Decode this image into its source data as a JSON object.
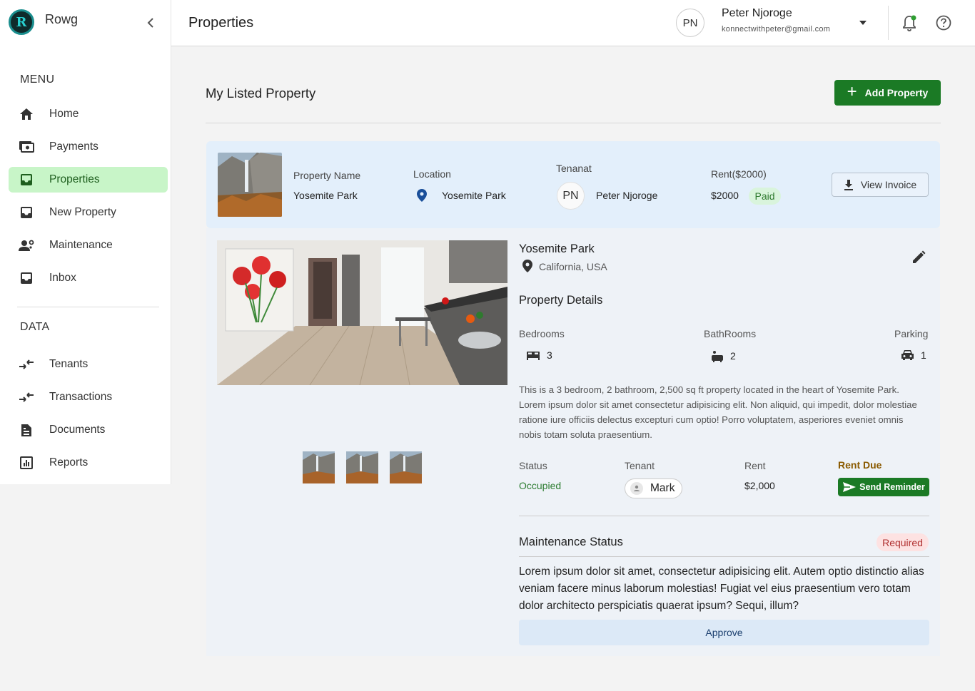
{
  "app": {
    "brand": "Rowg",
    "page_title": "Properties"
  },
  "user": {
    "initials": "PN",
    "name": "Peter Njoroge",
    "email": "konnectwithpeter@gmail.com"
  },
  "sidebar": {
    "menu_title": "MENU",
    "data_title": "DATA",
    "menu_items": [
      {
        "label": "Home",
        "icon": "home-icon"
      },
      {
        "label": "Payments",
        "icon": "payments-icon"
      },
      {
        "label": "Properties",
        "icon": "inbox-icon",
        "active": true
      },
      {
        "label": "New Property",
        "icon": "inbox-icon"
      },
      {
        "label": "Maintenance",
        "icon": "engineering-icon"
      },
      {
        "label": "Inbox",
        "icon": "inbox-icon"
      }
    ],
    "data_items": [
      {
        "label": "Tenants",
        "icon": "compare-arrows-icon"
      },
      {
        "label": "Transactions",
        "icon": "compare-arrows-icon"
      },
      {
        "label": "Documents",
        "icon": "document-icon"
      },
      {
        "label": "Reports",
        "icon": "bar-chart-icon"
      }
    ]
  },
  "main": {
    "heading": "My Listed Property",
    "add_button": "Add Property"
  },
  "summary": {
    "property_name_label": "Property Name",
    "property_name": "Yosemite Park",
    "location_label": "Location",
    "location": "Yosemite Park",
    "tenant_label": "Tenanat",
    "tenant_initials": "PN",
    "tenant_name": "Peter Njoroge",
    "rent_label": "Rent($2000)",
    "rent_value": "$2000",
    "paid_status": "Paid",
    "invoice_button": "View Invoice"
  },
  "details": {
    "title": "Yosemite Park",
    "location": "California, USA",
    "section_title": "Property Details",
    "bedrooms_label": "Bedrooms",
    "bedrooms": "3",
    "bathrooms_label": "BathRooms",
    "bathrooms": "2",
    "parking_label": "Parking",
    "parking": "1",
    "description": "This is a 3 bedroom, 2 bathroom, 2,500 sq ft property located in the heart of Yosemite Park. Lorem ipsum dolor sit amet consectetur adipisicing elit. Non aliquid, qui impedit, dolor molestiae ratione iure officiis delectus excepturi cum optio! Porro voluptatem, asperiores eveniet omnis nobis totam soluta praesentium.",
    "status_label": "Status",
    "status": "Occupied",
    "tenant_label": "Tenant",
    "tenant": "Mark",
    "rent_label": "Rent",
    "rent": "$2,000",
    "rent_due_label": "Rent Due",
    "reminder_button": "Send Reminder",
    "maintenance_title": "Maintenance Status",
    "maintenance_badge": "Required",
    "maintenance_text": "Lorem ipsum dolor sit amet, consectetur adipisicing elit. Autem optio distinctio alias veniam facere minus laborum molestias! Fugiat vel eius praesentium vero totam dolor architecto perspiciatis quaerat ipsum? Sequi, illum?",
    "approve_button": "Approve"
  },
  "colors": {
    "primary_green": "#1b7a25",
    "active_nav": "#c8f5c8",
    "summary_bg": "#e3effb",
    "panel_bg": "#eef2f7"
  }
}
